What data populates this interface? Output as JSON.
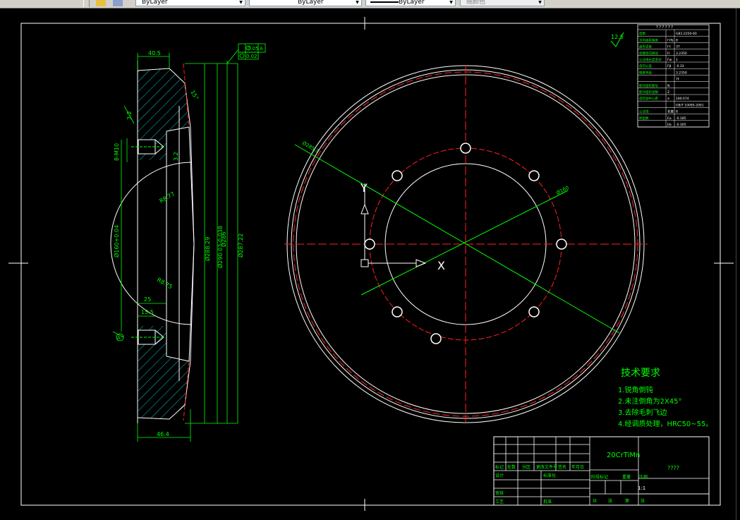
{
  "toolbar": {
    "layer_combo": "ByLayer",
    "linetype_combo": "ByLayer",
    "lineweight_combo": "ByLayer",
    "plotstyle_combo": "随颜色"
  },
  "colors": {
    "dim": "#00ff00",
    "outline": "#ffffff",
    "center": "#ff2020",
    "hatch": "#00ffff",
    "ucs": "#ffffff"
  },
  "section_view": {
    "dims": {
      "top_width": "40.5",
      "bottom_width": "46.4",
      "hole_thread": "8-M10",
      "hole_depth": "15.5",
      "hole_spacing": "25",
      "center_bore": "Ø160+0.04",
      "radius_top": "R8.77",
      "radius_bottom": "R8.75",
      "chamfer_top": "3.2",
      "chamfer_small": "3.2",
      "dia_1": "Ø288.29",
      "dia_2": "Ø290.03-0.038",
      "dia_3": "Ø286",
      "dia_4": "Ø287.22",
      "datum_label": "A",
      "tolerance_1": "0.05",
      "tolerance_datum": "A",
      "tolerance_2": "0.02",
      "angle": "15°"
    }
  },
  "front_view": {
    "dim_outer": "Ø285.3",
    "dim_pitch": "Ø160",
    "axis_x": "X",
    "axis_y": "Y"
  },
  "roughness": "12.5",
  "param_table": {
    "header": "? ? ? ? ? ?",
    "rows": [
      [
        "齿数",
        "",
        "GB1:2250-60"
      ],
      [
        "法向齿距偏差",
        "f Pb",
        "8"
      ],
      [
        "齿形误差",
        "f f",
        "37"
      ],
      [
        "齿圈径向跳动",
        "Fr",
        "3.2350"
      ],
      [
        "公法线长度变动",
        "Fw",
        "1"
      ],
      [
        "齿向公差",
        "Fβ",
        "-0.33"
      ],
      [
        "精度等级",
        "",
        "3.2350"
      ],
      [
        "",
        "",
        "7f"
      ],
      [
        "配对齿轮图号",
        "N",
        ""
      ],
      [
        "配对齿轮齿数",
        "Z",
        ""
      ],
      [
        "齿轮副中心距",
        "a",
        "180.074"
      ],
      [
        "",
        "",
        "GB/T 10095-2001"
      ],
      [
        "公法线",
        "长度",
        "8"
      ],
      [
        "跨齿数",
        "Ea",
        "-0.185"
      ],
      [
        "",
        "Eb",
        "-0.305"
      ]
    ]
  },
  "tech_requirements": {
    "title": "技术要求",
    "items": [
      "1.锐角倒钝",
      "2.未注倒角为2X45°",
      "3.去除毛刺飞边",
      "4.经调质处理，HRC50~55。"
    ]
  },
  "title_block": {
    "material": "20CrTiMn",
    "drawing_name": "????",
    "scale": "1:1",
    "labels": [
      "标记",
      "处数",
      "分区",
      "更改文件号",
      "签名",
      "年月日",
      "设计",
      "标准化",
      "审核",
      "工艺",
      "批准",
      "阶段标记",
      "重量",
      "比例",
      "共",
      "张",
      "第",
      "张"
    ]
  }
}
